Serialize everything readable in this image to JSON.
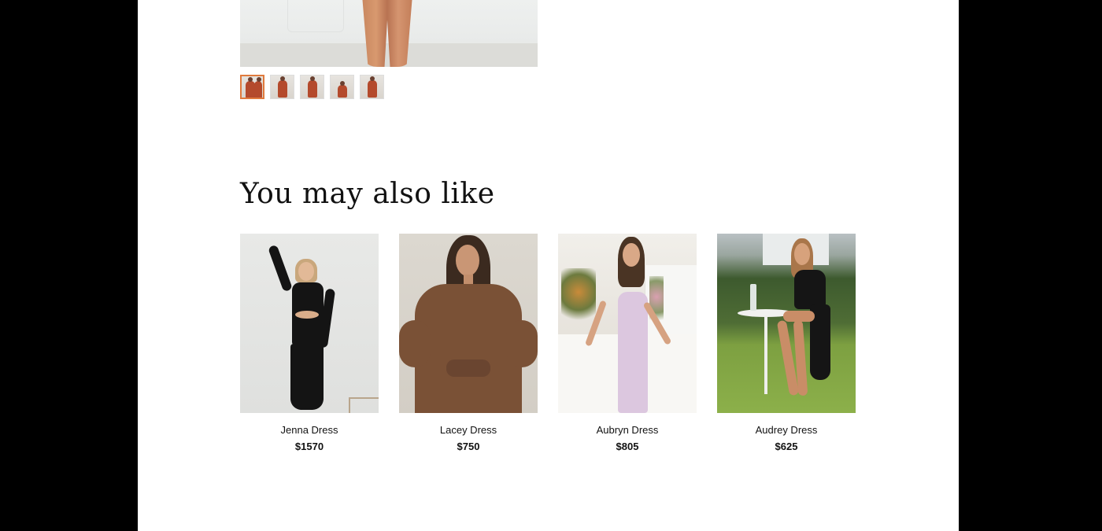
{
  "gallery": {
    "thumbnails": [
      {
        "name": "thumbnail-1",
        "active": true
      },
      {
        "name": "thumbnail-2",
        "active": false
      },
      {
        "name": "thumbnail-3",
        "active": false
      },
      {
        "name": "thumbnail-4",
        "active": false
      },
      {
        "name": "thumbnail-5",
        "active": false
      }
    ],
    "accent_color": "#e07a3d"
  },
  "recommendations": {
    "title": "You may also like",
    "products": [
      {
        "name": "Jenna Dress",
        "price": "$1570"
      },
      {
        "name": "Lacey Dress",
        "price": "$750"
      },
      {
        "name": "Aubryn Dress",
        "price": "$805"
      },
      {
        "name": "Audrey Dress",
        "price": "$625"
      }
    ]
  }
}
